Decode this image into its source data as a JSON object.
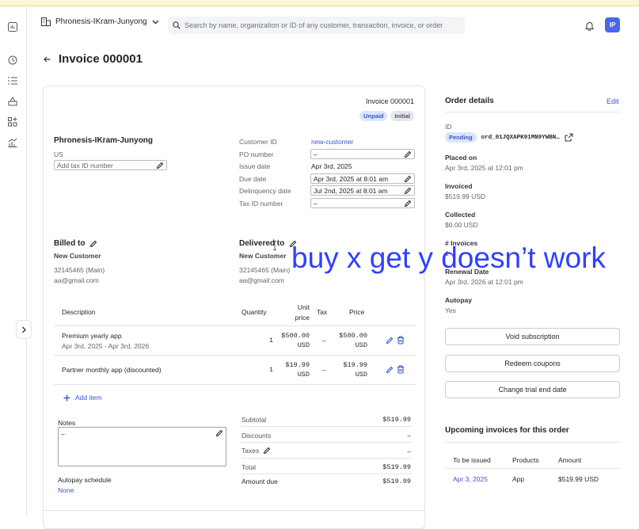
{
  "topbar": {
    "org_name": "Phronesis-IKram-Junyong",
    "search_placeholder": "Search by name, organization or ID of any customer, transaction, invoice, or order",
    "avatar_initials": "IP"
  },
  "page": {
    "title": "Invoice 000001"
  },
  "invoice": {
    "label": "Invoice 000001",
    "badges": [
      "Unpaid",
      "Initial"
    ],
    "seller": {
      "name": "Phronesis-IKram-Junyong",
      "country": "US",
      "tax_id_placeholder": "Add tax ID number"
    },
    "meta": {
      "customer_id_label": "Customer ID",
      "customer_id_value": "new-customer",
      "po_label": "PO number",
      "po_value": "–",
      "issue_label": "Issue date",
      "issue_value": "Apr 3rd, 2025",
      "due_label": "Due date",
      "due_value": "Apr 3rd, 2025 at 8:01 am",
      "delinquency_label": "Delinquency date",
      "delinquency_value": "Jul 2nd, 2025 at 8:01 am",
      "taxid_label": "Tax ID number",
      "taxid_value": "–"
    },
    "billed_to": {
      "heading": "Billed to",
      "name": "New Customer",
      "phone": "32145465 (Main)",
      "email": "aa@gmail.com"
    },
    "delivered_to": {
      "heading": "Delivered to",
      "name": "New Customer",
      "phone": "32145465 (Main)",
      "email": "aa@gmail.com"
    },
    "table": {
      "headers": {
        "description": "Description",
        "quantity": "Quantity",
        "unit_price_1": "Unit",
        "unit_price_2": "price",
        "tax": "Tax",
        "price": "Price"
      },
      "rows": [
        {
          "description": "Premium yearly app",
          "period": "Apr 3rd, 2025 - Apr 3rd, 2026",
          "quantity": "1",
          "unit_price": "$500.00",
          "unit_currency": "USD",
          "tax": "–",
          "price": "$500.00",
          "price_currency": "USD"
        },
        {
          "description": "Partner monthly app (discounted)",
          "period": "",
          "quantity": "1",
          "unit_price": "$19.99",
          "unit_currency": "USD",
          "tax": "–",
          "price": "$19.99",
          "price_currency": "USD"
        }
      ],
      "add_item": "Add item"
    },
    "notes": {
      "label": "Notes",
      "value": "–"
    },
    "autopay": {
      "label": "Autopay schedule",
      "value": "None"
    },
    "totals": {
      "subtotal_label": "Subtotal",
      "subtotal_value": "$519.99",
      "discounts_label": "Discounts",
      "discounts_value": "–",
      "taxes_label": "Taxes",
      "taxes_value": "–",
      "total_label": "Total",
      "total_value": "$519.99",
      "due_label": "Amount due",
      "due_value": "$519.99"
    }
  },
  "overlay": {
    "text": "buy x get y doesn’t work"
  },
  "order_details": {
    "heading": "Order details",
    "edit": "Edit",
    "id_label": "ID",
    "status": "Pending",
    "order_id": "ord_01JQXAPK91MN9YWBN…",
    "placed_label": "Placed on",
    "placed_value": "Apr 3rd, 2025 at 12:01 pm",
    "invoiced_label": "Invoiced",
    "invoiced_value": "$519.99 USD",
    "collected_label": "Collected",
    "collected_value": "$0.00 USD",
    "invoices_label": "# Invoices",
    "invoices_value": "1",
    "renewal_label": "Renewal Date",
    "renewal_value": "Apr 3rd, 2026 at 12:01 pm",
    "autopay_label": "Autopay",
    "autopay_value": "Yes",
    "buttons": [
      "Void subscription",
      "Redeem coupons",
      "Change trial end date"
    ]
  },
  "upcoming": {
    "heading": "Upcoming invoices for this order",
    "headers": [
      "To be issued",
      "Products",
      "Amount"
    ],
    "rows": [
      {
        "date": "Apr 3, 2025",
        "product": "App",
        "amount": "$519.99 USD"
      }
    ]
  }
}
